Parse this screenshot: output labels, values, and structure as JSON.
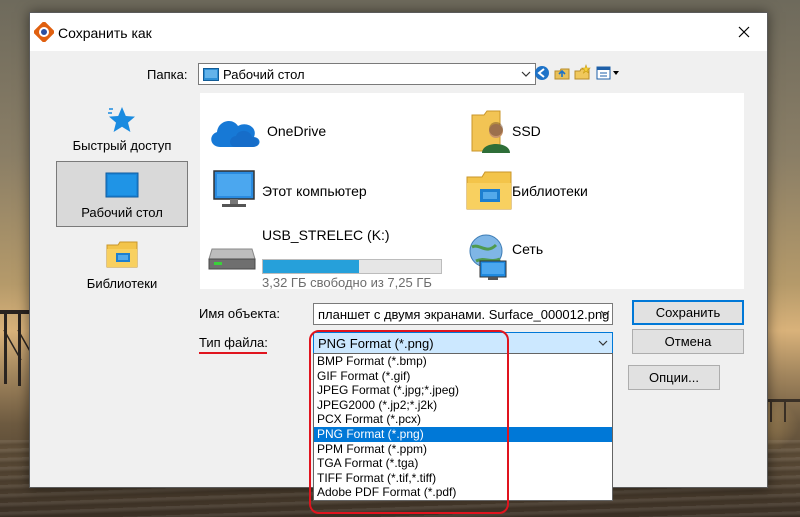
{
  "dialog": {
    "title": "Сохранить как",
    "close_glyph": "✕"
  },
  "folder": {
    "label": "Папка:",
    "value": "Рабочий стол"
  },
  "toolbar": {
    "icons": [
      "back-icon",
      "up-folder-icon",
      "new-folder-icon",
      "view-menu-icon"
    ]
  },
  "nav": {
    "items": [
      {
        "label": "Быстрый доступ",
        "icon": "star-icon"
      },
      {
        "label": "Рабочий стол",
        "icon": "desktop-icon",
        "selected": true
      },
      {
        "label": "Библиотеки",
        "icon": "libraries-icon"
      }
    ]
  },
  "view": {
    "items": [
      {
        "label": "OneDrive",
        "icon": "onedrive-icon"
      },
      {
        "label": "SSD",
        "icon": "user-folder-icon"
      },
      {
        "label": "Этот компьютер",
        "icon": "computer-icon"
      },
      {
        "label": "Библиотеки",
        "icon": "libraries-icon"
      },
      {
        "label": "USB_STRELEC (K:)",
        "icon": "drive-icon",
        "detail": "3,32 ГБ свободно из 7,25 ГБ",
        "used_fraction": 0.54
      },
      {
        "label": "Сеть",
        "icon": "network-icon"
      }
    ]
  },
  "filename": {
    "label": "Имя объекта:",
    "value": "планшет с двумя экранами. Surface_000012.png"
  },
  "filetype": {
    "label": "Тип файла:",
    "selected": "PNG Format (*.png)",
    "options": [
      "BMP Format (*.bmp)",
      "GIF Format (*.gif)",
      "JPEG Format (*.jpg;*.jpeg)",
      "JPEG2000 (*.jp2;*.j2k)",
      "PCX Format (*.pcx)",
      "PNG Format (*.png)",
      "PPM Format (*.ppm)",
      "TGA Format (*.tga)",
      "TIFF Format (*.tif,*.tiff)",
      "Adobe PDF Format (*.pdf)"
    ],
    "selected_index": 5
  },
  "buttons": {
    "save": "Сохранить",
    "cancel": "Отмена",
    "options": "Опции..."
  },
  "colors": {
    "accent": "#0078d7",
    "highlight": "#e0141e",
    "progress": "#26a0da"
  }
}
